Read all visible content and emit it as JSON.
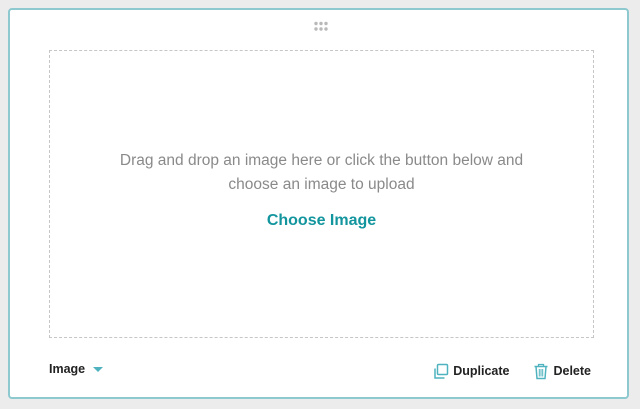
{
  "colors": {
    "card_border": "#8ec9cf",
    "accent": "#13959e",
    "icon": "#4fb3bf",
    "hint_text": "#8a8a8a",
    "label_text": "#222222"
  },
  "dropzone": {
    "hint_line1": "Drag and drop an image here or click the button below and",
    "hint_line2": "choose an image to upload",
    "button_label": "Choose Image"
  },
  "footer": {
    "type_label": "Image",
    "type_icon": "caret-down-icon",
    "duplicate_label": "Duplicate",
    "duplicate_icon": "duplicate-icon",
    "delete_label": "Delete",
    "delete_icon": "trash-icon"
  },
  "handle_icon": "drag-handle-icon"
}
